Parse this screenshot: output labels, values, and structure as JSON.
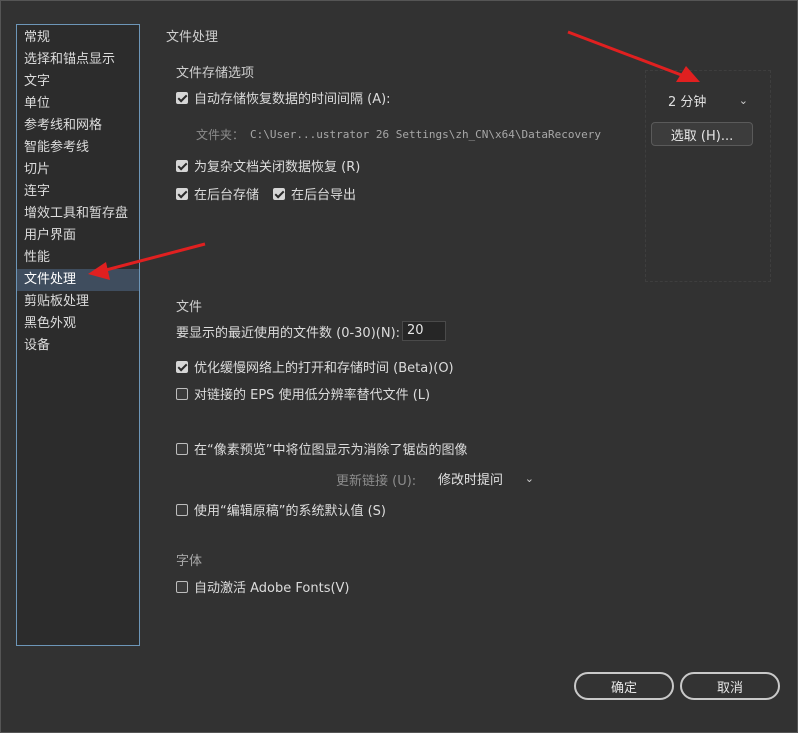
{
  "sidebar": {
    "items": [
      {
        "label": "常规"
      },
      {
        "label": "选择和锚点显示"
      },
      {
        "label": "文字"
      },
      {
        "label": "单位"
      },
      {
        "label": "参考线和网格"
      },
      {
        "label": "智能参考线"
      },
      {
        "label": "切片"
      },
      {
        "label": "连字"
      },
      {
        "label": "增效工具和暂存盘"
      },
      {
        "label": "用户界面"
      },
      {
        "label": "性能"
      },
      {
        "label": "文件处理"
      },
      {
        "label": "剪贴板处理"
      },
      {
        "label": "黑色外观"
      },
      {
        "label": "设备"
      }
    ],
    "active_index": 11
  },
  "main": {
    "section_title": "文件处理",
    "storage": {
      "title": "文件存储选项",
      "autosave_label": "自动存储恢复数据的时间间隔 (A):",
      "autosave_checked": true,
      "interval_value": "2 分钟",
      "folder_label": "文件夹：",
      "folder_path": "C:\\User...ustrator 26 Settings\\zh_CN\\x64\\DataRecovery",
      "browse_label": "选取 (H)...",
      "complex_label": "为复杂文档关闭数据恢复 (R)",
      "complex_checked": true,
      "bg_save_label": "在后台存储",
      "bg_save_checked": true,
      "bg_export_label": "在后台导出",
      "bg_export_checked": true
    },
    "files": {
      "title": "文件",
      "recent_label": "要显示的最近使用的文件数 (0-30)(N):",
      "recent_value": "20",
      "optimize_label": "优化缓慢网络上的打开和存储时间 (Beta)(O)",
      "optimize_checked": true,
      "eps_label": "对链接的 EPS 使用低分辨率替代文件 (L)",
      "eps_checked": false,
      "pixel_label": "在“像素预览”中将位图显示为消除了锯齿的图像",
      "pixel_checked": false,
      "update_label": "更新链接 (U):",
      "update_value": "修改时提问",
      "edit_original_label": "使用“编辑原稿”的系统默认值 (S)",
      "edit_original_checked": false
    },
    "fonts": {
      "title": "字体",
      "auto_activate_label": "自动激活 Adobe Fonts(V)",
      "auto_activate_checked": false
    }
  },
  "footer": {
    "ok_label": "确定",
    "cancel_label": "取消"
  },
  "colors": {
    "background": "#323232",
    "sidebar_border": "#6d96b8",
    "annotation_arrow": "#e02020"
  }
}
